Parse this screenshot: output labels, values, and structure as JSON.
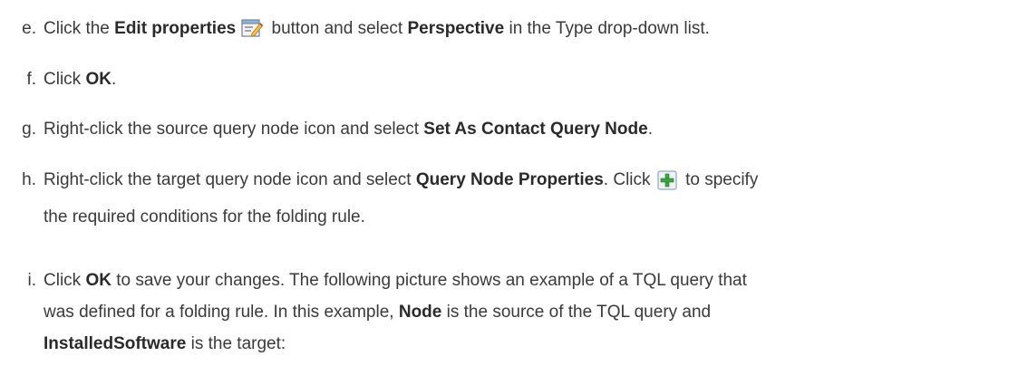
{
  "steps": [
    {
      "letter": "e.",
      "parts": [
        "Click the ",
        "Edit properties",
        " button and select ",
        "Perspective",
        " in the Type drop-down list."
      ],
      "icon": "edit-properties-icon"
    },
    {
      "letter": "f.",
      "parts": [
        "Click ",
        "OK",
        "."
      ]
    },
    {
      "letter": "g.",
      "parts": [
        "Right-click the source query node icon and select ",
        "Set As Contact Query Node",
        "."
      ]
    },
    {
      "letter": "h.",
      "parts": [
        "Right-click the target query node icon and select ",
        "Query Node Properties",
        ". Click ",
        " to specify"
      ],
      "line2": "the required conditions for the folding rule.",
      "icon": "add-condition-icon"
    },
    {
      "letter": "i.",
      "parts": [
        "Click ",
        "OK",
        " to save your changes. The following picture shows an example of a TQL query that"
      ],
      "line2": "was defined for a folding rule. In this example, ",
      "line2_bold": "Node",
      "line2_rest": " is the source of the TQL query and",
      "line3_bold": "InstalledSoftware",
      "line3_rest": " is the target:"
    }
  ]
}
